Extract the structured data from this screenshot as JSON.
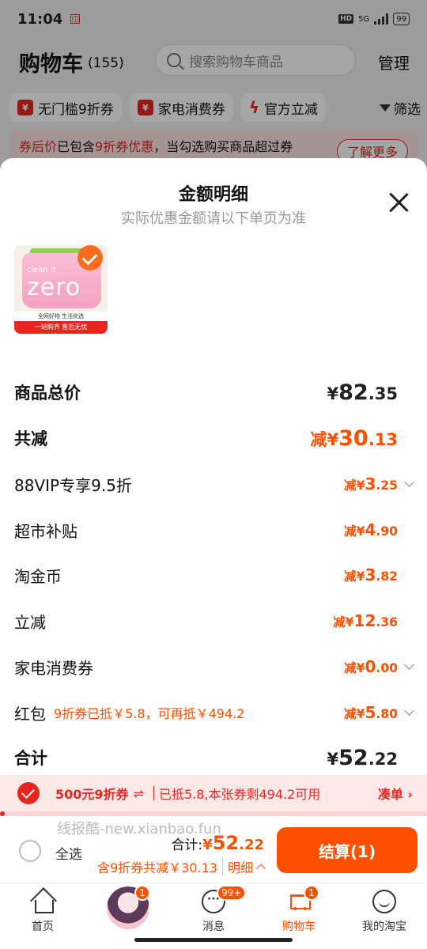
{
  "status": {
    "time": "11:04",
    "hd": "HD",
    "net": "5G",
    "battery": "99"
  },
  "header": {
    "title": "购物车",
    "count": "(155)",
    "search_placeholder": "搜索购物车商品",
    "manage": "管理"
  },
  "filters": [
    "无门槛9折券",
    "家电消费券",
    "官方立减",
    "筛选"
  ],
  "notice": {
    "red": "券后价",
    "text1": "已包含",
    "red2": "9折券优惠",
    "text2": "，当勾选购买商品超过券",
    "learn_more": "了解更多"
  },
  "sheet": {
    "title": "金额明细",
    "subtitle": "实际优惠金额请以下单页为准",
    "product": {
      "line1": "clean it",
      "line2": "zero",
      "band1": "全网好物 生活优选",
      "band2": "一站购齐 售后无忧"
    },
    "rows": [
      {
        "label": "商品总价",
        "prefix": "¥",
        "int": "82",
        "dec": ".35"
      },
      {
        "label": "共减",
        "prefix": "减¥",
        "int": "30",
        "dec": ".13"
      },
      {
        "label": "88VIP专享9.5折",
        "prefix": "减¥",
        "int": "3",
        "dec": ".25"
      },
      {
        "label": "超市补贴",
        "prefix": "减¥",
        "int": "4",
        "dec": ".90"
      },
      {
        "label": "淘金币",
        "prefix": "减¥",
        "int": "3",
        "dec": ".82"
      },
      {
        "label": "立减",
        "prefix": "减¥",
        "int": "12",
        "dec": ".36"
      },
      {
        "label": "家电消费券",
        "prefix": "减¥",
        "int": "0",
        "dec": ".00"
      },
      {
        "label": "红包",
        "note": "9折券已抵￥5.8，可再抵￥494.2",
        "prefix": "减¥",
        "int": "5",
        "dec": ".80"
      },
      {
        "label": "合计",
        "prefix": "¥",
        "int": "52",
        "dec": ".22"
      }
    ]
  },
  "coupon_bar": {
    "name": "500元9折券",
    "used": "已抵5.8,本张券剩494.2可用",
    "link": "凑单 ›",
    "progress": 0.012
  },
  "checkout": {
    "watermark": "线报酷-new.xianbao.fun",
    "select_all": "全选",
    "total_label": "合计:",
    "total_prefix": "¥",
    "total_int": "52",
    "total_dec": ".22",
    "sub": "含9折券共减￥30.13",
    "detail": "明细",
    "pay": "结算(1)"
  },
  "tabs": [
    {
      "label": "首页",
      "icon": "home-icon"
    },
    {
      "label": "",
      "icon": "avatar",
      "badge": "1"
    },
    {
      "label": "消息",
      "icon": "message-icon",
      "badge": "99+"
    },
    {
      "label": "购物车",
      "icon": "cart-icon",
      "badge": "1"
    },
    {
      "label": "我的淘宝",
      "icon": "smile-icon"
    }
  ],
  "colors": {
    "accent": "#ff5000",
    "red": "#e6261f"
  }
}
